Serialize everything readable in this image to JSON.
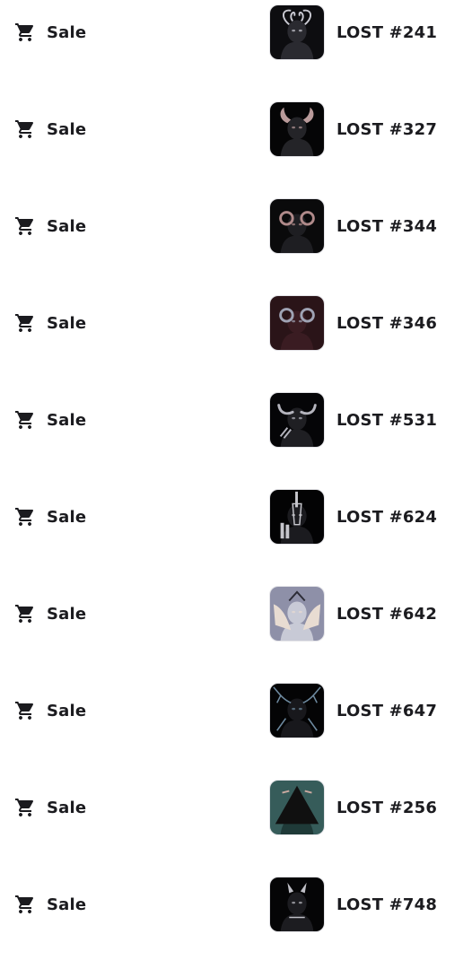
{
  "rows": [
    {
      "event": "Sale",
      "icon": "cart-icon",
      "item": "LOST #241",
      "art": {
        "bg": "#0d0d10",
        "figure": "#2a2a30",
        "accent": "#c9c9d2",
        "motif": "tendrils"
      }
    },
    {
      "event": "Sale",
      "icon": "cart-icon",
      "item": "LOST #327",
      "art": {
        "bg": "#050506",
        "figure": "#242428",
        "accent": "#b99a9a",
        "motif": "horns"
      }
    },
    {
      "event": "Sale",
      "icon": "cart-icon",
      "item": "LOST #344",
      "art": {
        "bg": "#0a0a0b",
        "figure": "#1e1e22",
        "accent": "#b08a8a",
        "motif": "ram"
      }
    },
    {
      "event": "Sale",
      "icon": "cart-icon",
      "item": "LOST #346",
      "art": {
        "bg": "#2a1418",
        "figure": "#3a1c22",
        "accent": "#9fa3b4",
        "motif": "ram"
      }
    },
    {
      "event": "Sale",
      "icon": "cart-icon",
      "item": "LOST #531",
      "art": {
        "bg": "#050507",
        "figure": "#1f1f23",
        "accent": "#b4b4bd",
        "motif": "bull"
      }
    },
    {
      "event": "Sale",
      "icon": "cart-icon",
      "item": "LOST #624",
      "art": {
        "bg": "#030304",
        "figure": "#1b1b1f",
        "accent": "#c6c6cc",
        "motif": "spike"
      }
    },
    {
      "event": "Sale",
      "icon": "cart-icon",
      "item": "LOST #642",
      "art": {
        "bg": "#8e90a8",
        "figure": "#c8cad6",
        "accent": "#e8dcd2",
        "motif": "wings"
      }
    },
    {
      "event": "Sale",
      "icon": "cart-icon",
      "item": "LOST #647",
      "art": {
        "bg": "#040405",
        "figure": "#18181c",
        "accent": "#6e8aa0",
        "motif": "antlers"
      }
    },
    {
      "event": "Sale",
      "icon": "cart-icon",
      "item": "LOST #256",
      "art": {
        "bg": "#365c5a",
        "figure": "#1f3a38",
        "accent": "#101010",
        "motif": "triangle"
      }
    },
    {
      "event": "Sale",
      "icon": "cart-icon",
      "item": "LOST #748",
      "art": {
        "bg": "#050506",
        "figure": "#1c1c20",
        "accent": "#bfbfc6",
        "motif": "devil"
      }
    }
  ]
}
